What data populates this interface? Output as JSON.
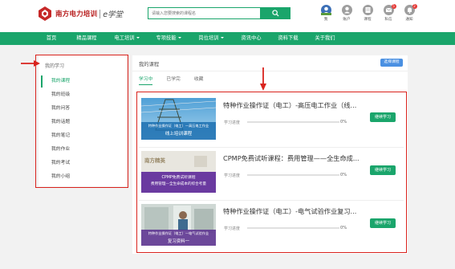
{
  "header": {
    "logo_text": "南方电力培训",
    "logo_sub": "e学堂",
    "search_placeholder": "请输入您要搜索的课程名"
  },
  "tools": [
    {
      "label": "我",
      "icon": "user-avatar-icon"
    },
    {
      "label": "账户",
      "icon": "account-icon"
    },
    {
      "label": "课程",
      "icon": "course-icon"
    },
    {
      "label": "私信",
      "icon": "message-icon",
      "badge": "5"
    },
    {
      "label": "通知",
      "icon": "bell-icon",
      "badge": "2"
    }
  ],
  "nav": [
    "首页",
    "精品课程",
    "电工培训",
    "专项技能",
    "岗位培训",
    "资讯中心",
    "资料下载",
    "关于我们"
  ],
  "sidebar": {
    "title": "我的学习",
    "items": [
      "我的课程",
      "我的班级",
      "我的问答",
      "我的话题",
      "我的笔记",
      "我的作业",
      "我的考试",
      "我的小组"
    ]
  },
  "main": {
    "title": "我的课程",
    "head_button": "选择课程",
    "tabs": [
      "学习中",
      "已学完",
      "收藏"
    ],
    "progress_label": "学习进度",
    "continue_label": "继续学习"
  },
  "courses": [
    {
      "title": "特种作业操作证（电工）-高压电工作业（线...",
      "progress": "0%",
      "thumb_caption": "特种作业操作证（电工）—高压电工作业",
      "thumb_sub": "线上培训课程"
    },
    {
      "title": "CPMP免费试听课程：费用管理——全生命成...",
      "progress": "0%",
      "thumb_caption": "CPMP免费试听课程",
      "thumb_sub": "费用管理—全生命成本的综合考量",
      "thumb_brand": "南方精英"
    },
    {
      "title": "特种作业操作证（电工）-电气试验作业复习...",
      "progress": "0%",
      "thumb_caption": "特种作业操作证（电工）—电气试验作业",
      "thumb_sub": "复习资料一"
    }
  ],
  "colors": {
    "brand_green": "#1aa56b",
    "annotation_red": "#d9231d",
    "button_blue": "#4a90e2"
  }
}
